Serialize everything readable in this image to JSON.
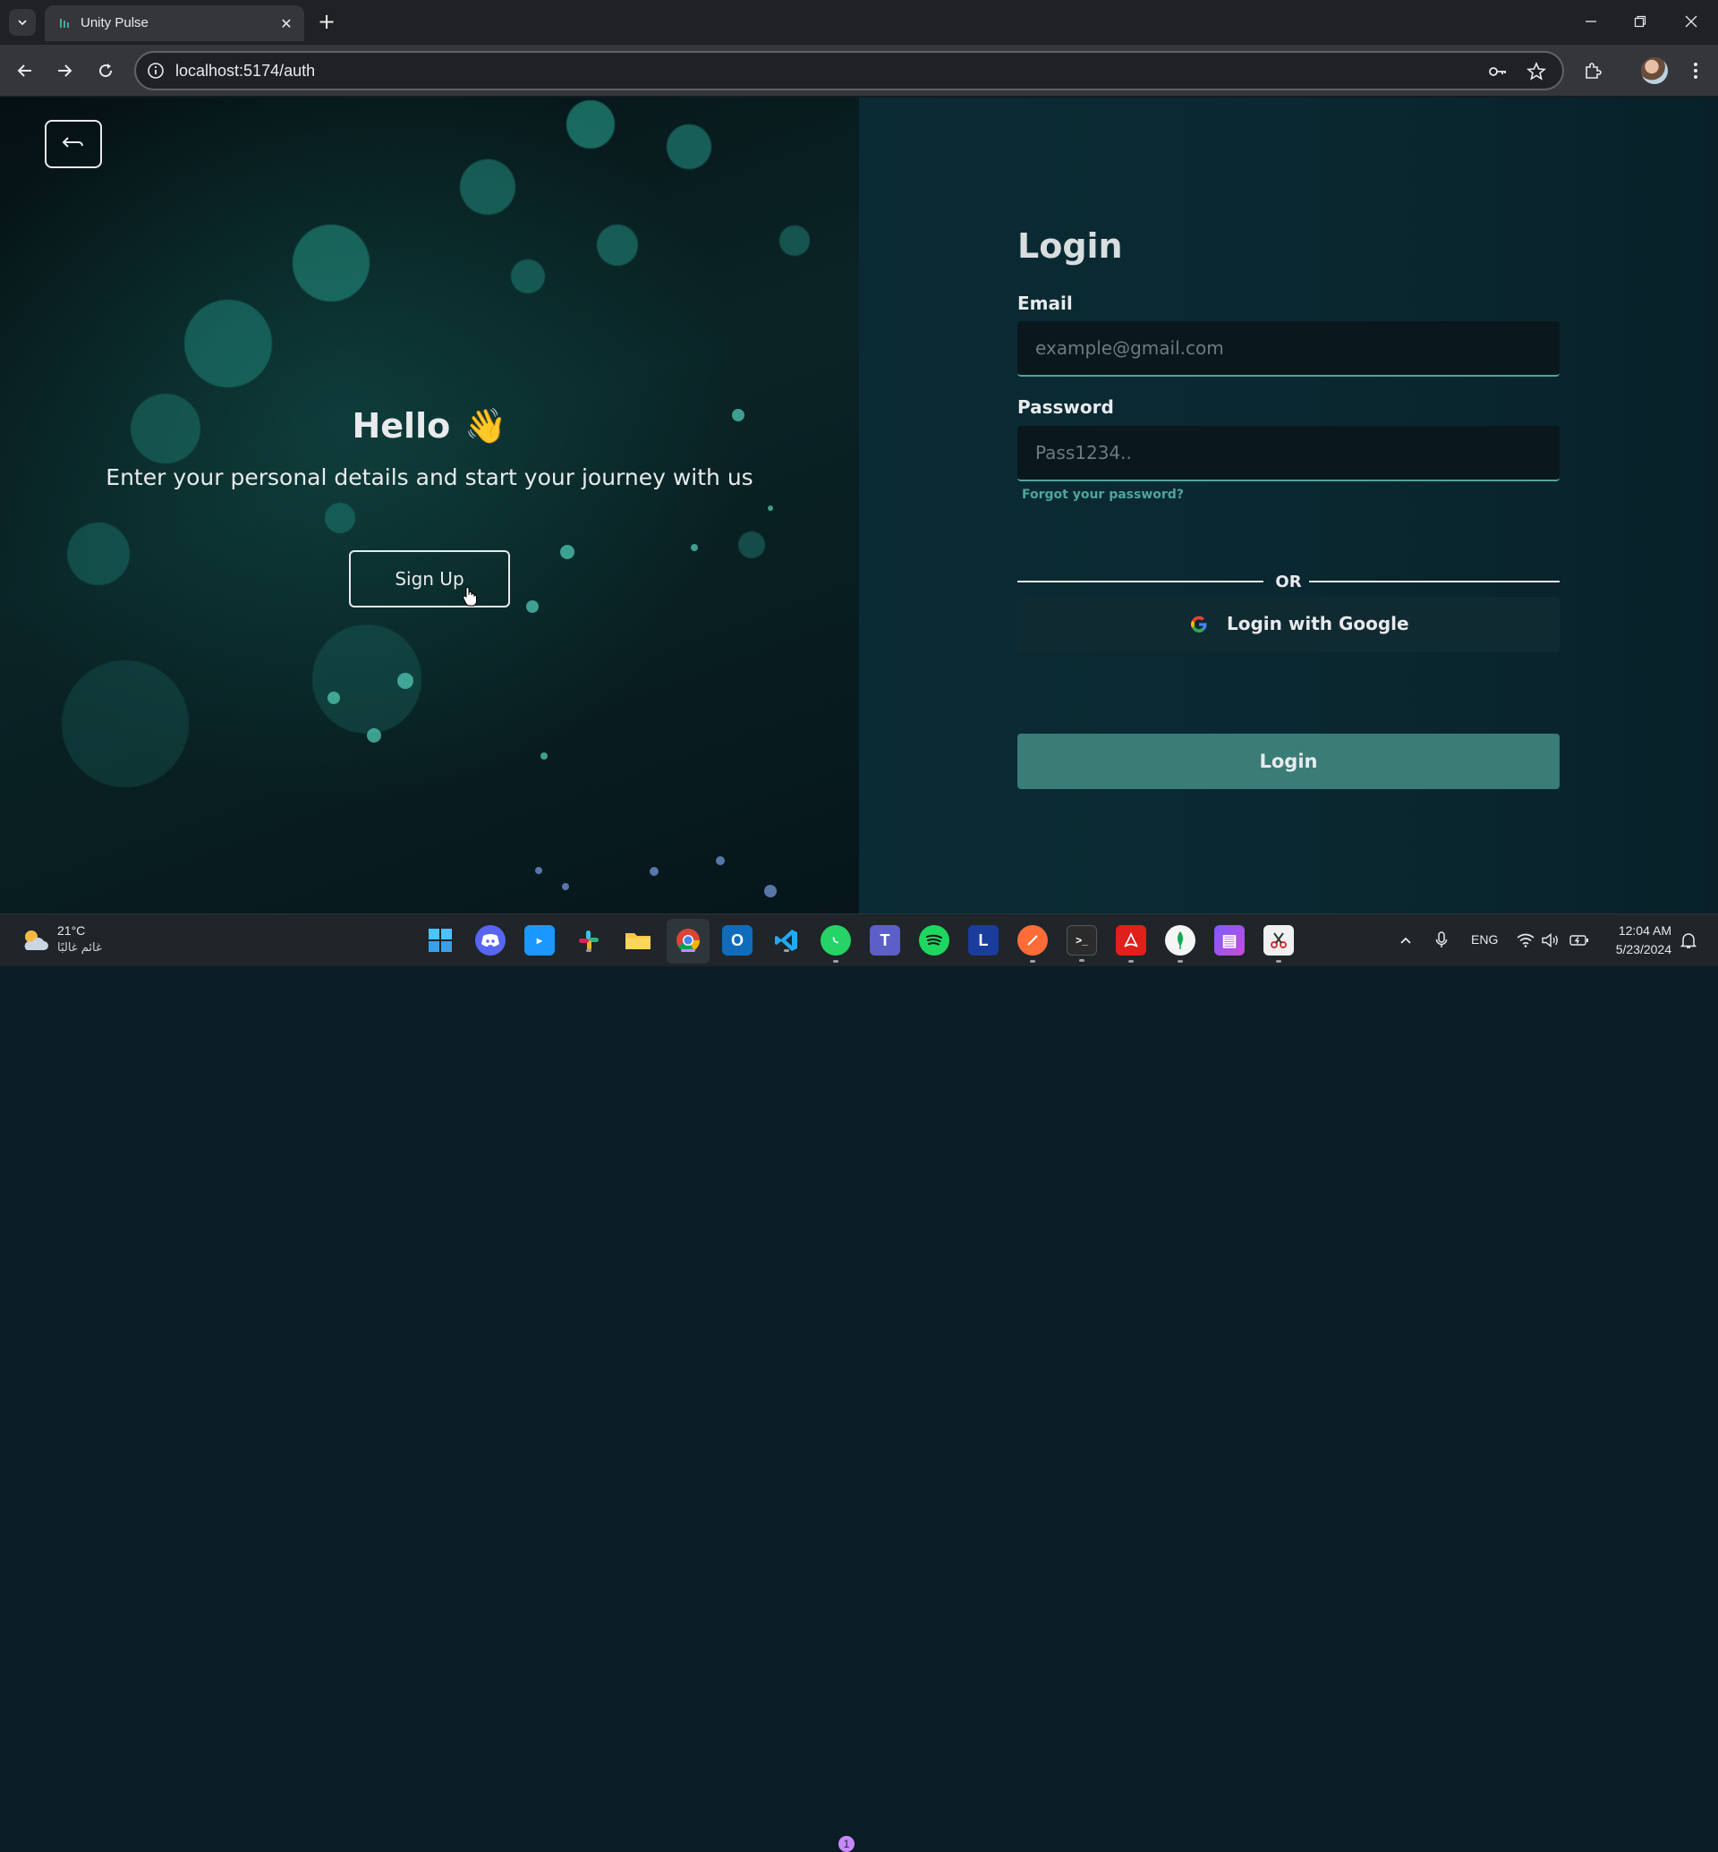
{
  "browser": {
    "tab_title": "Unity Pulse",
    "url": "localhost:5174/auth"
  },
  "hero": {
    "greeting": "Hello",
    "greeting_emoji": "👋",
    "subtitle": "Enter your personal details and start your journey with us",
    "signup_label": "Sign Up"
  },
  "login": {
    "title": "Login",
    "email_label": "Email",
    "email_placeholder": "example@gmail.com",
    "password_label": "Password",
    "password_placeholder": "Pass1234..",
    "forgot_label": "Forgot your password?",
    "or_label": "OR",
    "google_label": "Login with Google",
    "submit_label": "Login"
  },
  "colors": {
    "accent": "#3a7c76",
    "accent_light": "#4fa59a",
    "panel_bg": "#0b2b34"
  },
  "taskbar": {
    "weather_temp": "21°C",
    "weather_condition": "غائم غالبًا",
    "language": "ENG",
    "time": "12:04 AM",
    "date": "5/23/2024",
    "whatsapp_badge": "1",
    "apps": [
      "start",
      "discord",
      "prime-video",
      "slack",
      "file-explorer",
      "chrome",
      "outlook",
      "vscode",
      "whatsapp",
      "teams",
      "spotify",
      "l-app",
      "postman",
      "terminal",
      "acrobat",
      "mongodb-compass",
      "video-editor",
      "snipping-tool"
    ]
  }
}
